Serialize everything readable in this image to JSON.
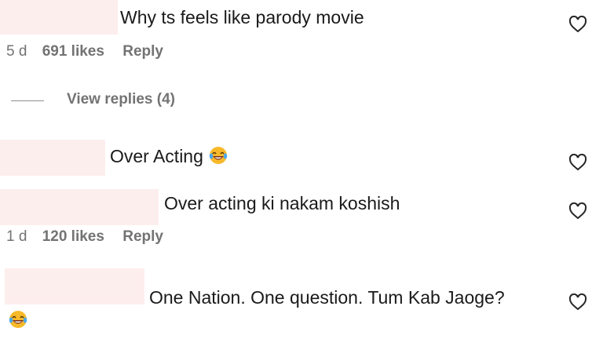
{
  "comments": [
    {
      "text": "Why ts feels like parody movie",
      "time": "5 d",
      "likes": "691 likes",
      "reply_label": "Reply"
    },
    {
      "text": "Over Acting",
      "emoji": "laughing-tears-emoji"
    },
    {
      "text": "Over acting ki nakam koshish",
      "time": "1 d",
      "likes": "120 likes",
      "reply_label": "Reply"
    },
    {
      "text": "One Nation. One question. Tum Kab Jaoge?",
      "emoji": "laughing-tears-emoji"
    }
  ],
  "view_replies_label": "View replies (4)",
  "icons": {
    "like": "heart-outline-icon"
  },
  "colors": {
    "redaction": "#fdeeee",
    "meta_text": "#737373",
    "body_text": "#1a1a1a"
  }
}
